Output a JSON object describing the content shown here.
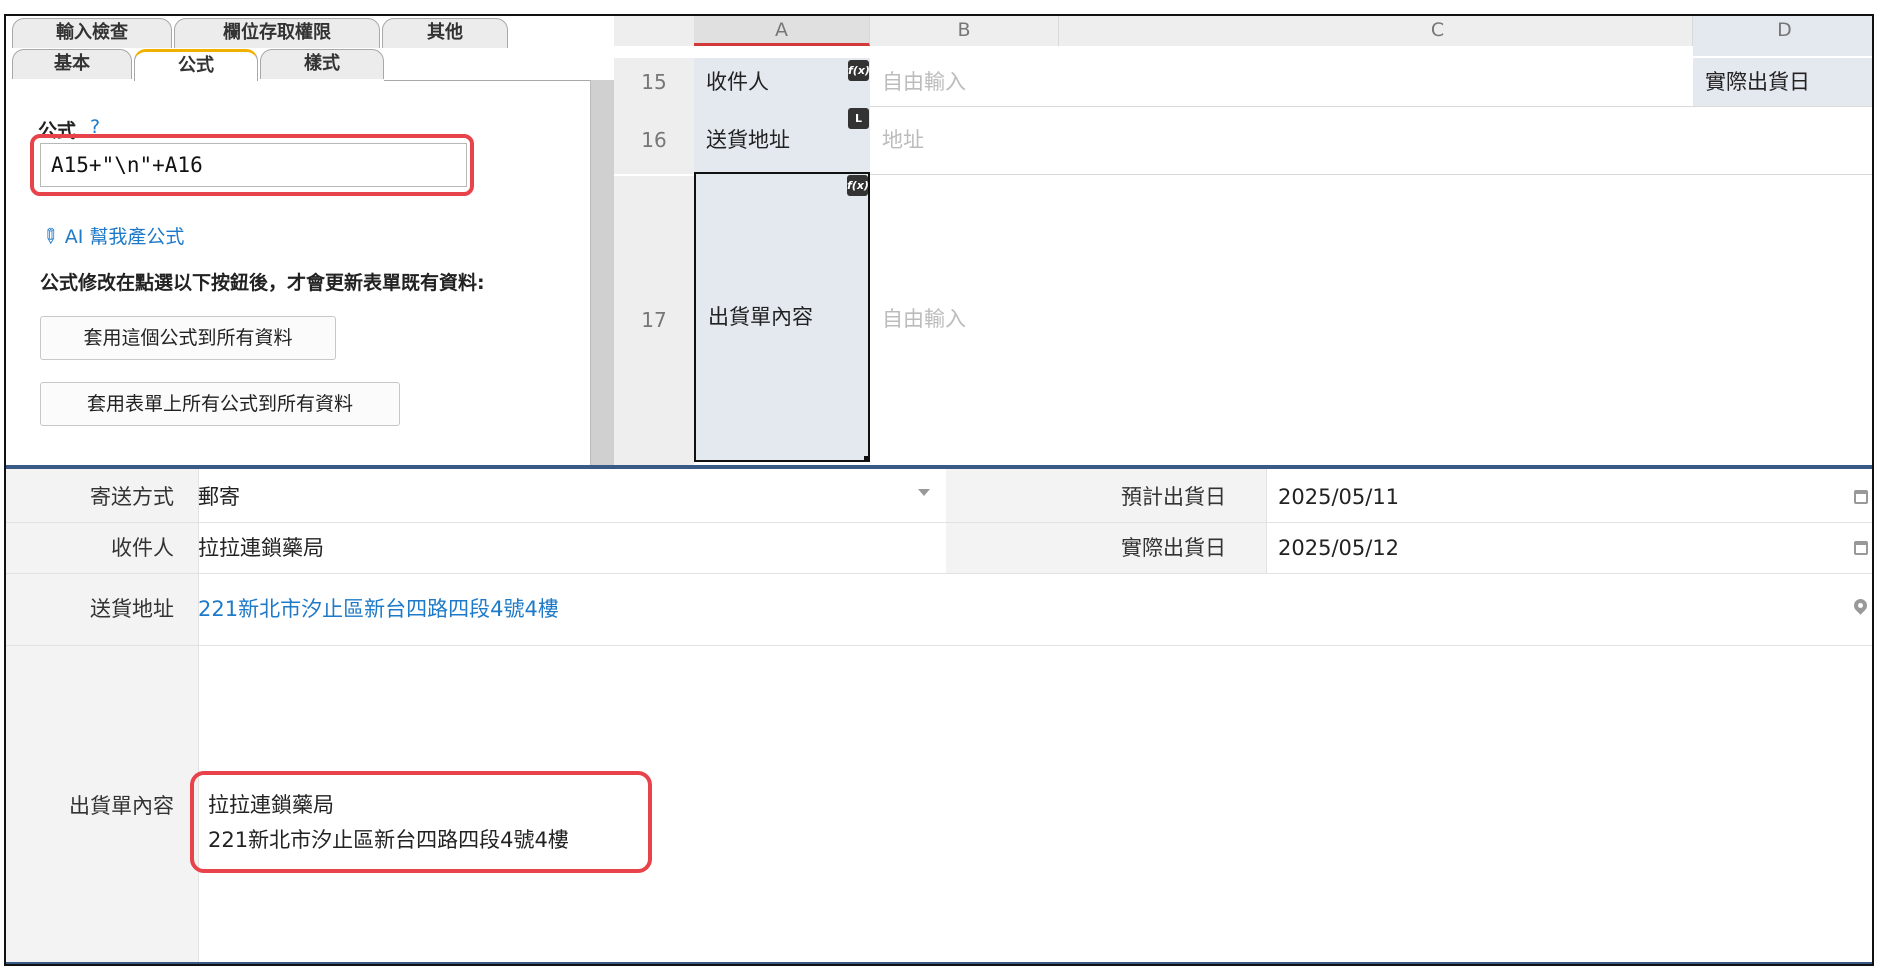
{
  "tabs": {
    "row1": [
      "輸入檢查",
      "欄位存取權限",
      "其他"
    ],
    "row2": [
      "基本",
      "公式",
      "樣式"
    ]
  },
  "formula_panel": {
    "label": "公式",
    "help": "?",
    "formula_value": "A15+\"\\n\"+A16",
    "ai_link": "AI 幫我產公式",
    "update_note": "公式修改在點選以下按鈕後，才會更新表單既有資料:",
    "apply_button": "套用這個公式到所有資料",
    "apply_all_button": "套用表單上所有公式到所有資料"
  },
  "sheet": {
    "columns": [
      "A",
      "B",
      "C",
      "D"
    ],
    "rows": [
      {
        "num": "15",
        "a": "收件人",
        "badge": "f(x)",
        "b_placeholder": "自由輸入",
        "d": "實際出貨日"
      },
      {
        "num": "16",
        "a": "送貨地址",
        "badge": "L",
        "b_placeholder": "地址"
      },
      {
        "num": "17",
        "a": "出貨單內容",
        "badge": "f(x)",
        "b_placeholder": "自由輸入"
      }
    ]
  },
  "form": {
    "ship_method": {
      "label": "寄送方式",
      "value": "郵寄"
    },
    "recipient": {
      "label": "收件人",
      "value": "拉拉連鎖藥局"
    },
    "address": {
      "label": "送貨地址",
      "value": "221新北市汐止區新台四路四段4號4樓"
    },
    "content": {
      "label": "出貨單內容",
      "line1": "拉拉連鎖藥局",
      "line2": "221新北市汐止區新台四路四段4號4樓"
    },
    "est_ship_date": {
      "label": "預計出貨日",
      "value": "2025/05/11"
    },
    "act_ship_date": {
      "label": "實際出貨日",
      "value": "2025/05/12"
    }
  },
  "icons": {
    "formula_badge": "function-icon",
    "location_badge": "location-type-icon",
    "calendar": "calendar-icon",
    "map": "map-pin-icon",
    "pencil": "pencil-icon"
  },
  "colors": {
    "highlight": "#e8424a",
    "link": "#1e7ac8",
    "active_tab_accent": "#f0b000",
    "form_border": "#3a5a86",
    "selected_cell": "#e4e8ef"
  }
}
